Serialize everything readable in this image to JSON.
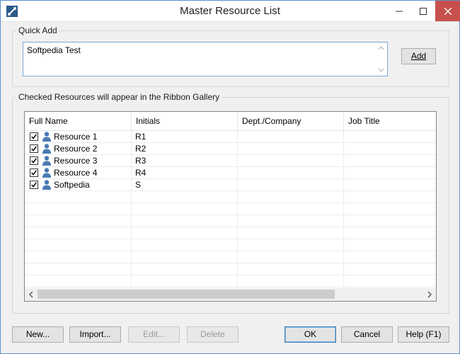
{
  "window": {
    "title": "Master Resource List"
  },
  "quick_add": {
    "group_label": "Quick Add",
    "input_value": "Softpedia Test",
    "add_button": "Add"
  },
  "resources": {
    "group_label": "Checked Resources will appear in the Ribbon Gallery",
    "columns": [
      "Full Name",
      "Initials",
      "Dept./Company",
      "Job Title"
    ],
    "rows": [
      {
        "checked": true,
        "name": "Resource 1",
        "initials": "R1",
        "dept": "",
        "job": ""
      },
      {
        "checked": true,
        "name": "Resource 2",
        "initials": "R2",
        "dept": "",
        "job": ""
      },
      {
        "checked": true,
        "name": "Resource 3",
        "initials": "R3",
        "dept": "",
        "job": ""
      },
      {
        "checked": true,
        "name": "Resource 4",
        "initials": "R4",
        "dept": "",
        "job": ""
      },
      {
        "checked": true,
        "name": "Softpedia",
        "initials": "S",
        "dept": "",
        "job": ""
      }
    ]
  },
  "buttons": {
    "new": "New...",
    "import": "Import...",
    "edit": "Edit...",
    "delete": "Delete",
    "ok": "OK",
    "cancel": "Cancel",
    "help": "Help (F1)"
  },
  "colors": {
    "accent": "#3c7fb1",
    "close_button": "#c7504c",
    "person_icon": "#4a7ab5"
  }
}
